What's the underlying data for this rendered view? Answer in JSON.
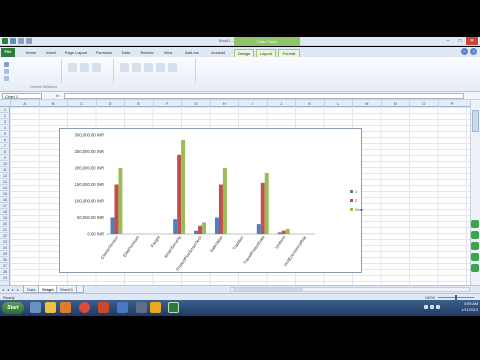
{
  "window": {
    "title": "Book1 - Microsoft Excel",
    "chart_tools_label": "Chart Tools",
    "controls": {
      "minimize": "–",
      "maximize": "□",
      "close": "✕"
    }
  },
  "ribbon": {
    "tabs": [
      "File",
      "Home",
      "Insert",
      "Page Layout",
      "Formulas",
      "Data",
      "Review",
      "View",
      "Add-Ins",
      "Acrobat"
    ],
    "context_tabs": [
      "Design",
      "Layout",
      "Format"
    ],
    "group_label": "Current Selection"
  },
  "formula_bar": {
    "name_box": "Chart 1",
    "fx": "fx",
    "value": ""
  },
  "columns": [
    "A",
    "B",
    "C",
    "D",
    "E",
    "F",
    "G",
    "H",
    "I",
    "J",
    "K",
    "L",
    "M",
    "N",
    "O",
    "P"
  ],
  "rows": [
    "1",
    "2",
    "3",
    "4",
    "5",
    "6",
    "7",
    "8",
    "9",
    "10",
    "11",
    "12",
    "13",
    "14",
    "15",
    "16",
    "17",
    "18",
    "19",
    "20",
    "21",
    "22",
    "23",
    "24",
    "25",
    "26",
    "27",
    "28",
    "29"
  ],
  "chart_data": {
    "type": "bar",
    "categories": [
      "ClassicVersion",
      "ElitePremium",
      "Freight",
      "SmartSecurity",
      "ProtectPlusSmartTech",
      "SafeValue",
      "Tradition",
      "TravelProtectData",
      "Uniform",
      "UnitEconomicsRisk"
    ],
    "series": [
      {
        "name": "1",
        "color": "#4f7fbf",
        "values": [
          50000,
          0,
          0,
          45000,
          10000,
          50000,
          0,
          30000,
          5000,
          0
        ]
      },
      {
        "name": "2",
        "color": "#c0504d",
        "values": [
          150000,
          0,
          0,
          240000,
          25000,
          150000,
          0,
          155000,
          10000,
          0
        ]
      },
      {
        "name": "Overall Result",
        "color": "#9bbb59",
        "values": [
          200000,
          0,
          0,
          285000,
          35000,
          200000,
          0,
          185000,
          15000,
          0
        ]
      }
    ],
    "ylim": [
      0,
      300000
    ],
    "yticks": [
      "0.00 INR",
      "50,000.00 INR",
      "100,000.00 INR",
      "150,000.00 INR",
      "200,000.00 INR",
      "250,000.00 INR",
      "300,000.00 INR"
    ],
    "ytick_values": [
      0,
      50000,
      100000,
      150000,
      200000,
      250000,
      300000
    ],
    "legend": "right",
    "grid": false
  },
  "sheets": [
    "Data",
    "Graph",
    "Sheet3"
  ],
  "active_sheet": "Graph",
  "status": {
    "text": "Ready",
    "zoom": "100%"
  },
  "taskbar": {
    "start": "Start",
    "time": "3:59 AM",
    "date": "1/11/2013"
  },
  "colors": {
    "excel_green": "#2c7d3a",
    "chart_tools_green": "#8ec36a",
    "close_red": "#c9463d"
  }
}
